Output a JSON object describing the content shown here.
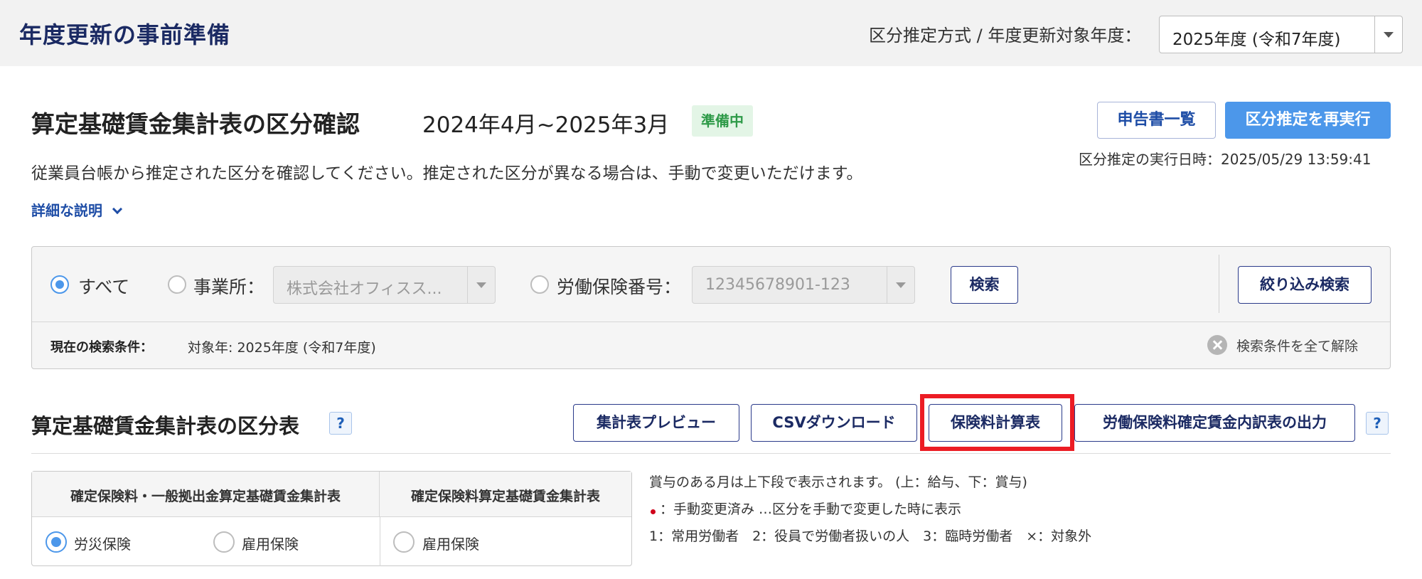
{
  "header": {
    "title": "年度更新の事前準備",
    "year_label": "区分推定方式 / 年度更新対象年度：",
    "year_value": "2025年度 (令和7年度)"
  },
  "section": {
    "title": "算定基礎賃金集計表の区分確認",
    "period": "2024年4月~2025年3月",
    "status": "準備中",
    "description": "従業員台帳から推定された区分を確認してください。推定された区分が異なる場合は、手動で変更いただけます。",
    "detail_link": "詳細な説明",
    "list_button": "申告書一覧",
    "rerun_button": "区分推定を再実行",
    "run_time": "区分推定の実行日時：2025/05/29 13:59:41"
  },
  "filter": {
    "all_label": "すべて",
    "office_label": "事業所：",
    "office_value": "株式会社オフィスス...",
    "insurance_label": "労働保険番号：",
    "insurance_value": "12345678901-123",
    "search_button": "検索",
    "narrow_button": "絞り込み検索",
    "condition_label": "現在の検索条件：",
    "condition_value": "対象年: 2025年度 (令和7年度)",
    "clear_label": "検索条件を全て解除"
  },
  "table": {
    "title": "算定基礎賃金集計表の区分表",
    "help": "?",
    "buttons": {
      "preview": "集計表プレビュー",
      "csv": "CSVダウンロード",
      "premium": "保険料計算表",
      "breakdown": "労働保険料確定賃金内訳表の出力"
    },
    "kinds": {
      "head1": "確定保険料・一般拠出金算定基礎賃金集計表",
      "head2": "確定保険料算定基礎賃金集計表",
      "rosai": "労災保険",
      "koyo1": "雇用保険",
      "koyo2": "雇用保険"
    },
    "notes": {
      "n1": "賞与のある月は上下段で表示されます。 (上：給与、下：賞与)",
      "n2": "：手動変更済み …区分を手動で変更した時に表示",
      "n3": "1：常用労働者　2：役員で労働者扱いの人　3：臨時労働者　×：対象外"
    }
  },
  "colors": {
    "accent": "#4c97ea",
    "title_navy": "#1b2a63",
    "highlight": "#ec1c24",
    "status_green": "#2e9a48"
  }
}
